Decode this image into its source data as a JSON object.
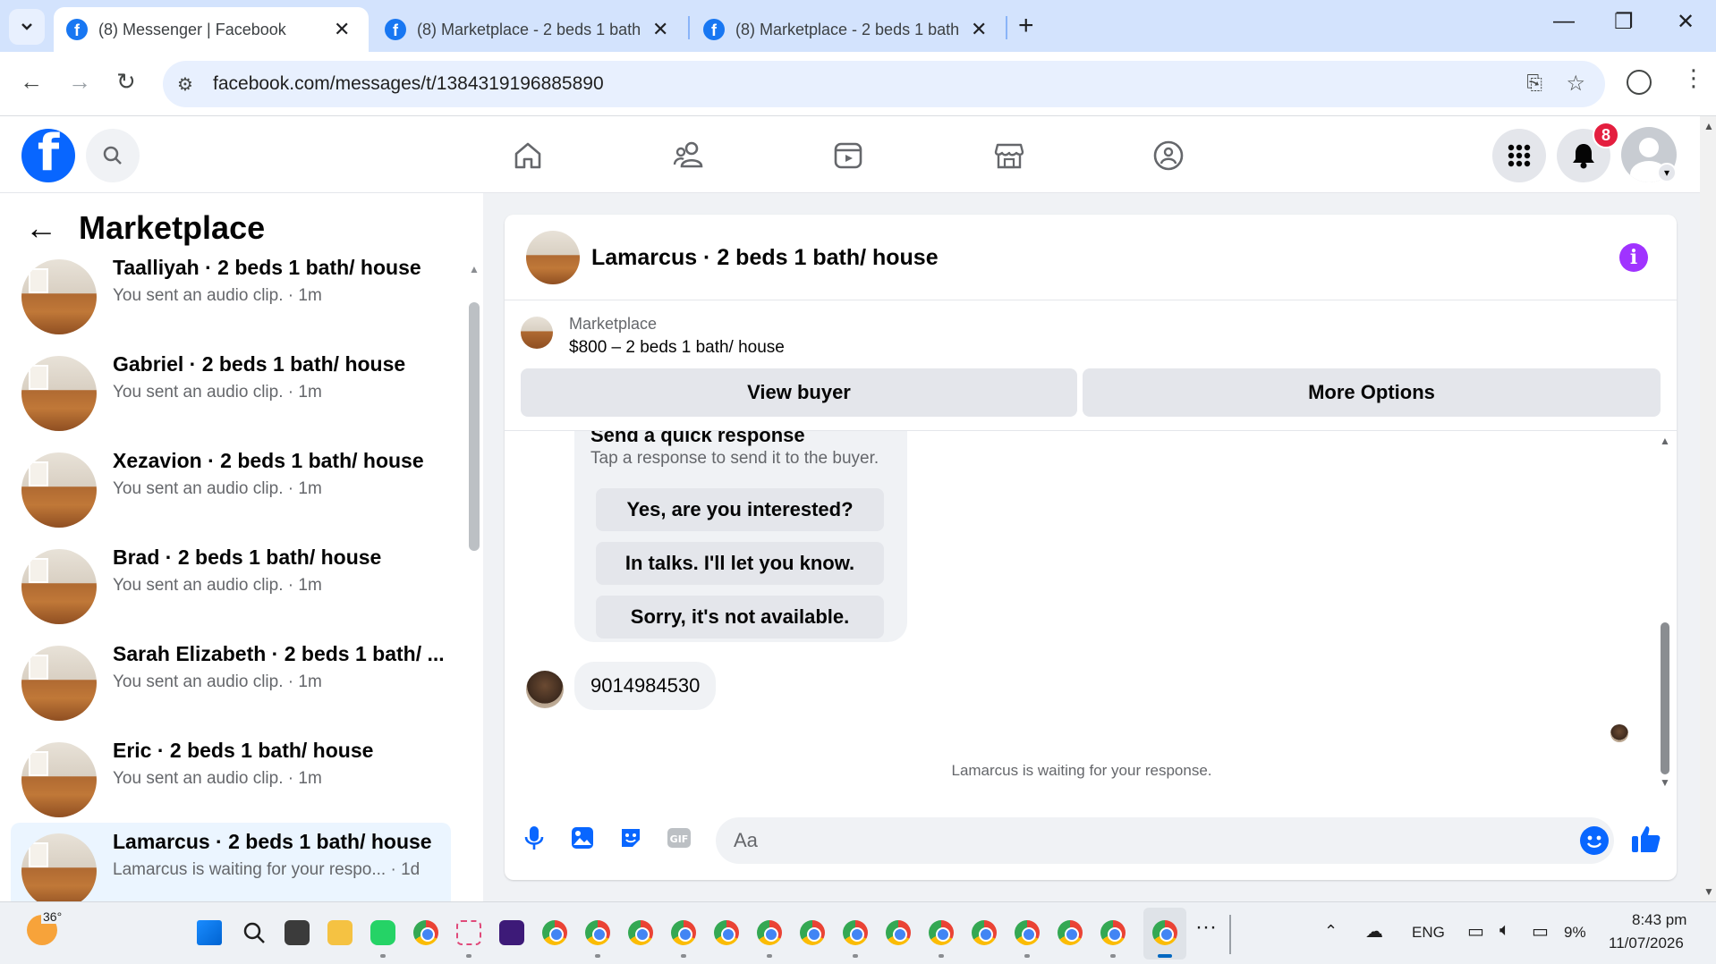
{
  "browser": {
    "tabs": [
      {
        "title": "(8) Messenger | Facebook",
        "active": true
      },
      {
        "title": "(8) Marketplace - 2 beds 1 bath",
        "active": false
      },
      {
        "title": "(8) Marketplace - 2 beds 1 bath",
        "active": false
      }
    ],
    "url": "facebook.com/messages/t/1384319196885890"
  },
  "fbnav": {
    "notification_count": "8"
  },
  "sidebar": {
    "title": "Marketplace",
    "conversations": [
      {
        "name": "Taalliyah · 2 beds 1 bath/ house",
        "preview": "You sent an audio clip. · 1m"
      },
      {
        "name": "Gabriel · 2 beds 1 bath/ house",
        "preview": "You sent an audio clip. · 1m"
      },
      {
        "name": "Xezavion · 2 beds 1 bath/ house",
        "preview": "You sent an audio clip. · 1m"
      },
      {
        "name": "Brad · 2 beds 1 bath/ house",
        "preview": "You sent an audio clip. · 1m"
      },
      {
        "name": "Sarah Elizabeth · 2 beds 1 bath/ ...",
        "preview": "You sent an audio clip. · 1m"
      },
      {
        "name": "Eric · 2 beds 1 bath/ house",
        "preview": "You sent an audio clip. · 1m"
      },
      {
        "name": "Lamarcus · 2 beds 1 bath/ house",
        "preview": "Lamarcus is waiting for your respo... · 1d",
        "active": true
      }
    ]
  },
  "chat": {
    "header_title": "Lamarcus · 2 beds 1 bath/ house",
    "listing": {
      "label": "Marketplace",
      "price_title": "$800 – 2 beds 1 bath/ house",
      "view_buyer": "View buyer",
      "more_options": "More Options"
    },
    "quick_response": {
      "title": "Send a quick response",
      "subtitle": "Tap a response to send it to the buyer.",
      "options": [
        "Yes, are you interested?",
        "In talks. I'll let you know.",
        "Sorry, it's not available."
      ]
    },
    "message": "9014984530",
    "waiting_text": "Lamarcus is waiting for your response.",
    "composer_placeholder": "Aa"
  },
  "taskbar": {
    "temperature": "36°",
    "language": "ENG",
    "battery": "9%",
    "time": "8:43 pm",
    "date": "11/07/2026"
  },
  "colors": {
    "fb_blue": "#0866ff",
    "badge_red": "#e41e3f",
    "info_purple": "#a033ff",
    "active_conv_bg": "#ebf5ff"
  }
}
